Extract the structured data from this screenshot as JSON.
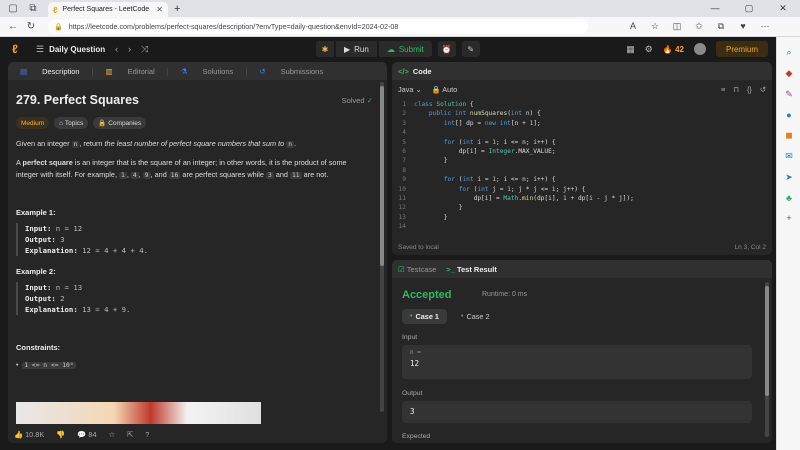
{
  "browser": {
    "tab_title": "Perfect Squares - LeetCode",
    "tab_close": "✕",
    "url": "https://leetcode.com/problems/perfect-squares/description/?envType=daily-question&envId=2024-02-08"
  },
  "topbar": {
    "daily_label": "Daily Question",
    "run_label": "Run",
    "submit_label": "Submit",
    "streak": "42",
    "premium_label": "Premium"
  },
  "left_tabs": [
    "Description",
    "Editorial",
    "Solutions",
    "Submissions"
  ],
  "problem": {
    "title": "279. Perfect Squares",
    "solved_label": "Solved",
    "difficulty": "Medium",
    "topics_label": "Topics",
    "companies_label": "Companies",
    "p1_a": "Given an integer ",
    "p1_n": "n",
    "p1_b": ", return ",
    "p1_i": "the least number of perfect square numbers that sum to",
    "p1_n2": "n",
    "p1_c": ".",
    "p2_a": "A ",
    "p2_b": "perfect square",
    "p2_c": " is an integer that is the square of an integer; in other words, it is the product of some integer with itself. For example, ",
    "p2_v1": "1",
    "p2_v2": "4",
    "p2_v3": "9",
    "p2_and": ", and ",
    "p2_v4": "16",
    "p2_d": " are perfect squares while ",
    "p2_v5": "3",
    "p2_e": " and ",
    "p2_v6": "11",
    "p2_f": " are not."
  },
  "examples": [
    {
      "title": "Example 1:",
      "input": "n = 12",
      "output": "3",
      "explanation": "12 = 4 + 4 + 4."
    },
    {
      "title": "Example 2:",
      "input": "n = 13",
      "output": "2",
      "explanation": "13 = 4 + 9."
    }
  ],
  "labels": {
    "input": "Input:",
    "output": "Output:",
    "explanation": "Explanation:"
  },
  "constraints_title": "Constraints:",
  "constraint": "1 <= n <= 10⁴",
  "left_footer": {
    "likes": "10.8K",
    "comments": "84"
  },
  "code_panel": {
    "title": "Code",
    "language": "Java",
    "auto": "Auto",
    "saved": "Saved to local",
    "cursor": "Ln 3, Col 2",
    "lines": [
      "class Solution {",
      "    public int numSquares(int n) {",
      "        int[] dp = new int[n + 1];",
      "",
      "        for (int i = 1; i <= n; i++) {",
      "            dp[i] = Integer.MAX_VALUE;",
      "        }",
      "",
      "        for (int i = 1; i <= n; i++) {",
      "            for (int j = 1; j * j <= i; j++) {",
      "                dp[i] = Math.min(dp[i], 1 + dp[i - j * j]);",
      "            }",
      "        }",
      ""
    ]
  },
  "test_panel": {
    "testcase_tab": "Testcase",
    "result_tab": "Test Result",
    "status": "Accepted",
    "runtime": "Runtime: 0 ms",
    "case1": "Case 1",
    "case2": "Case 2",
    "input_label": "Input",
    "var_name": "n =",
    "input_value": "12",
    "output_label": "Output",
    "output_value": "3",
    "expected_label": "Expected"
  }
}
